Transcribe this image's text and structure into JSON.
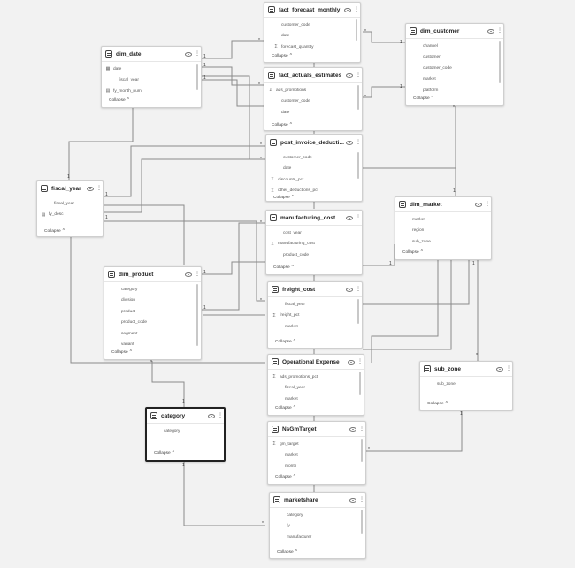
{
  "tables": [
    {
      "id": "fact_forecast_monthly",
      "title": "fact_forecast_monthly",
      "fields": [
        {
          "name": "customer_code",
          "icon": ""
        },
        {
          "name": "date",
          "icon": ""
        },
        {
          "name": "forecast_quantity",
          "icon": "Σ"
        }
      ],
      "collapse": "Collapse"
    },
    {
      "id": "dim_customer",
      "title": "dim_customer",
      "fields": [
        {
          "name": "channel",
          "icon": ""
        },
        {
          "name": "customer",
          "icon": ""
        },
        {
          "name": "customer_code",
          "icon": ""
        },
        {
          "name": "market",
          "icon": ""
        },
        {
          "name": "platform",
          "icon": ""
        }
      ],
      "collapse": "Collapse"
    },
    {
      "id": "dim_date",
      "title": "dim_date",
      "fields": [
        {
          "name": "date",
          "icon": "▦"
        },
        {
          "name": "fiscal_year",
          "icon": ""
        },
        {
          "name": "fy_month_num",
          "icon": "▤"
        }
      ],
      "collapse": "Collapse"
    },
    {
      "id": "fact_actuals_estimates",
      "title": "fact_actuals_estimates",
      "fields": [
        {
          "name": "ads_promotions",
          "icon": "Σ"
        },
        {
          "name": "customer_code",
          "icon": ""
        },
        {
          "name": "date",
          "icon": ""
        },
        {
          "name": "",
          "icon": ""
        }
      ],
      "collapse": "Collapse"
    },
    {
      "id": "post_invoice_deductions",
      "title": "post_invoice_deducti...",
      "fields": [
        {
          "name": "customer_code",
          "icon": ""
        },
        {
          "name": "date",
          "icon": ""
        },
        {
          "name": "discounts_pct",
          "icon": "Σ"
        },
        {
          "name": "other_deductions_pct",
          "icon": "Σ"
        }
      ],
      "collapse": "Collapse"
    },
    {
      "id": "fiscal_year",
      "title": "fiscal_year",
      "fields": [
        {
          "name": "fiscal_year",
          "icon": ""
        },
        {
          "name": "fy_desc",
          "icon": "▤"
        }
      ],
      "collapse": "Collapse"
    },
    {
      "id": "dim_market",
      "title": "dim_market",
      "fields": [
        {
          "name": "market",
          "icon": ""
        },
        {
          "name": "region",
          "icon": ""
        },
        {
          "name": "sub_zone",
          "icon": ""
        }
      ],
      "collapse": "Collapse"
    },
    {
      "id": "manufacturing_cost",
      "title": "manufacturing_cost",
      "fields": [
        {
          "name": "cost_year",
          "icon": ""
        },
        {
          "name": "manufacturing_cost",
          "icon": "Σ"
        },
        {
          "name": "product_code",
          "icon": ""
        }
      ],
      "collapse": "Collapse"
    },
    {
      "id": "dim_product",
      "title": "dim_product",
      "fields": [
        {
          "name": "category",
          "icon": ""
        },
        {
          "name": "division",
          "icon": ""
        },
        {
          "name": "product",
          "icon": ""
        },
        {
          "name": "product_code",
          "icon": ""
        },
        {
          "name": "segment",
          "icon": ""
        },
        {
          "name": "variant",
          "icon": ""
        }
      ],
      "collapse": "Collapse"
    },
    {
      "id": "freight_cost",
      "title": "freight_cost",
      "fields": [
        {
          "name": "fiscal_year",
          "icon": ""
        },
        {
          "name": "freight_pct",
          "icon": "Σ"
        },
        {
          "name": "market",
          "icon": ""
        }
      ],
      "collapse": "Collapse"
    },
    {
      "id": "operational_expense",
      "title": "Operational Expense",
      "fields": [
        {
          "name": "ads_promotions_pct",
          "icon": "Σ"
        },
        {
          "name": "fiscal_year",
          "icon": ""
        },
        {
          "name": "market",
          "icon": ""
        }
      ],
      "collapse": "Collapse"
    },
    {
      "id": "sub_zone",
      "title": "sub_zone",
      "fields": [
        {
          "name": "sub_zone",
          "icon": ""
        }
      ],
      "collapse": "Collapse"
    },
    {
      "id": "category",
      "title": "category",
      "fields": [
        {
          "name": "category",
          "icon": ""
        }
      ],
      "collapse": "Collapse"
    },
    {
      "id": "nsgm_target",
      "title": "NsGmTarget",
      "fields": [
        {
          "name": "gm_target",
          "icon": "Σ"
        },
        {
          "name": "market",
          "icon": ""
        },
        {
          "name": "month",
          "icon": ""
        }
      ],
      "collapse": "Collapse"
    },
    {
      "id": "marketshare",
      "title": "marketshare",
      "fields": [
        {
          "name": "category",
          "icon": ""
        },
        {
          "name": "fy",
          "icon": ""
        },
        {
          "name": "manufacturer",
          "icon": ""
        }
      ],
      "collapse": "Collapse"
    }
  ],
  "cardinality": {
    "one": "1",
    "many": "*"
  }
}
